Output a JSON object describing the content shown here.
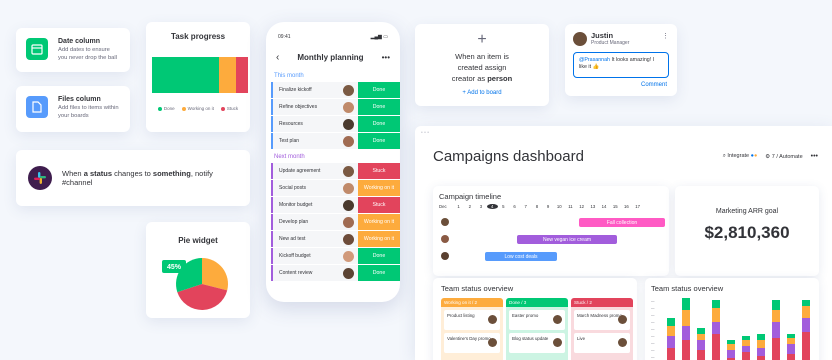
{
  "features": [
    {
      "title": "Date column",
      "desc": "Add dates to ensure you never drop the ball",
      "icon": "calendar-icon",
      "color": "#00c875"
    },
    {
      "title": "Files column",
      "desc": "Add files to items within your boards",
      "icon": "file-icon",
      "color": "#579bfc"
    }
  ],
  "task_progress": {
    "title": "Task progress",
    "legend": [
      "Done",
      "Working on it",
      "Stuck"
    ],
    "colors": {
      "done": "#00c875",
      "working": "#fdab3d",
      "stuck": "#e2445c"
    }
  },
  "automation": {
    "prefix": "When ",
    "bold1": "a status",
    "mid": " changes to ",
    "bold2": "something",
    "suffix": ", notify #channel",
    "icon": "slack-icon"
  },
  "pie": {
    "title": "Pie widget",
    "label": "45%"
  },
  "phone": {
    "time": "09:41",
    "title": "Monthly planning",
    "group1": "This month",
    "group2": "Next month",
    "rows1": [
      {
        "name": "Finalize kickoff",
        "status": "Done",
        "color": "#00c875"
      },
      {
        "name": "Refine objectives",
        "status": "Done",
        "color": "#00c875"
      },
      {
        "name": "Resources",
        "status": "Done",
        "color": "#00c875"
      },
      {
        "name": "Test plan",
        "status": "Done",
        "color": "#00c875"
      }
    ],
    "rows2": [
      {
        "name": "Update agreement",
        "status": "Stuck",
        "color": "#e2445c"
      },
      {
        "name": "Social posts",
        "status": "Working on it",
        "color": "#fdab3d"
      },
      {
        "name": "Monitor budget",
        "status": "Stuck",
        "color": "#e2445c"
      },
      {
        "name": "Develop plan",
        "status": "Working on it",
        "color": "#fdab3d"
      },
      {
        "name": "New ad test",
        "status": "Working on it",
        "color": "#fdab3d"
      },
      {
        "name": "Kickoff budget",
        "status": "Done",
        "color": "#00c875"
      },
      {
        "name": "Content review",
        "status": "Done",
        "color": "#00c875"
      }
    ]
  },
  "new_item": {
    "line1": "When an item is",
    "line2": "created assign",
    "line3_pre": "creator as ",
    "line3_bold": "person",
    "link": "+ Add to board"
  },
  "justin": {
    "name": "Justin",
    "role": "Product Manager",
    "mention": "@Prasannah",
    "msg": " It looks amazing! I like it 👍",
    "comment": "Comment"
  },
  "dashboard": {
    "title": "Campaigns dashboard",
    "integrate": "Integrate",
    "automate": "7 / Automate",
    "timeline": {
      "title": "Campaign timeline",
      "month": "Dec",
      "days": [
        "1",
        "2",
        "3",
        "4",
        "5",
        "6",
        "7",
        "8",
        "9",
        "10",
        "11",
        "12",
        "13",
        "14",
        "15",
        "16",
        "17"
      ],
      "bars": [
        {
          "label": "Fall collection",
          "color": "#ff5ac4"
        },
        {
          "label": "New vegan ice cream",
          "color": "#a25ddc"
        },
        {
          "label": "Low cost deals",
          "color": "#579bfc"
        }
      ]
    },
    "arr": {
      "label": "Marketing ARR goal",
      "value": "$2,810,360"
    },
    "team1": {
      "title": "Team status overview",
      "cols": [
        {
          "head": "Working on it / 2",
          "color": "#fdab3d",
          "cards": [
            "Product listing",
            "Valentine's Day promo"
          ]
        },
        {
          "head": "Done / 3",
          "color": "#00c875",
          "cards": [
            "Easter promo",
            "Blog status update"
          ]
        },
        {
          "head": "Stuck / 2",
          "color": "#e2445c",
          "cards": [
            "March Madness promo",
            "Live"
          ]
        }
      ]
    },
    "team2": {
      "title": "Team status overview"
    }
  }
}
